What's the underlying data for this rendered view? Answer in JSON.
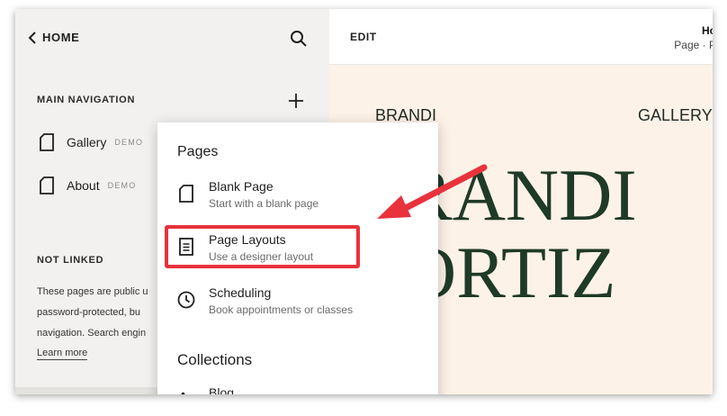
{
  "sidebar": {
    "back_label": "HOME",
    "main_navigation_title": "MAIN NAVIGATION",
    "nav_items": [
      {
        "label": "Gallery",
        "badge": "DEMO"
      },
      {
        "label": "About",
        "badge": "DEMO"
      }
    ],
    "not_linked_title": "NOT LINKED",
    "help_lines": [
      "These pages are public u",
      "password-protected, bu",
      "navigation. Search engin"
    ],
    "learn_more": "Learn more"
  },
  "topbar": {
    "edit_label": "EDIT",
    "page_name": "Ho",
    "page_sub": "Page · P"
  },
  "site_preview": {
    "nav_left": "BRANDI",
    "nav_right": "GALLERY",
    "hero_line1": "RANDI",
    "hero_line2": "ORTIZ"
  },
  "popup": {
    "pages_heading": "Pages",
    "options": [
      {
        "title": "Blank Page",
        "description": "Start with a blank page",
        "icon": "page-icon"
      },
      {
        "title": "Page Layouts",
        "description": "Use a designer layout",
        "icon": "layout-icon"
      },
      {
        "title": "Scheduling",
        "description": "Book appointments or classes",
        "icon": "clock-icon"
      }
    ],
    "collections_heading": "Collections",
    "collections_first": "Blog"
  },
  "colors": {
    "highlight": "#e8323c",
    "hero_text": "#1f3a27",
    "preview_bg": "#fdf2e8"
  }
}
